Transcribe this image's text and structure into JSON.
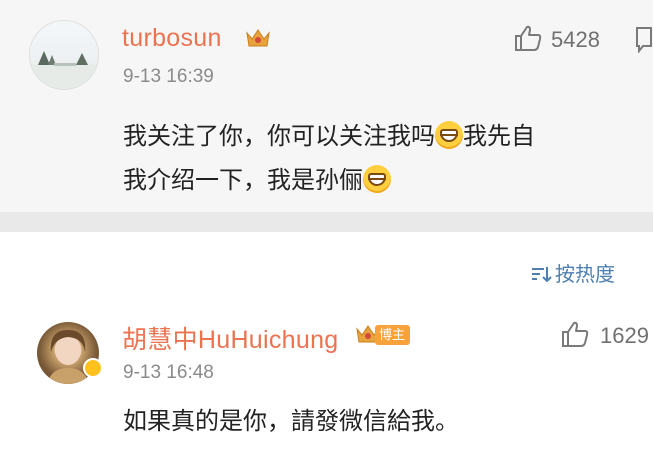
{
  "comments": [
    {
      "username": "turbosun",
      "time": "9-13 16:39",
      "text_line1_a": "我关注了你，你可以关注我吗",
      "text_line1_b": "我先自",
      "text_line2": "我介绍一下，我是孙俪",
      "likes": "5428",
      "emoji": "grin-emoji"
    },
    {
      "username": "胡慧中HuHuichung",
      "badge": "博主",
      "time": "9-13 16:48",
      "text": "如果真的是你，請發微信給我。",
      "likes": "1629"
    }
  ],
  "sort_label": "按热度",
  "colors": {
    "username": "#eb7350",
    "sort": "#4d7fb0",
    "badge": "#f7a23b",
    "crown": "#e8a33d"
  },
  "icons": [
    "like-icon",
    "crown-icon",
    "sort-icon",
    "more-icon",
    "verified-icon"
  ]
}
